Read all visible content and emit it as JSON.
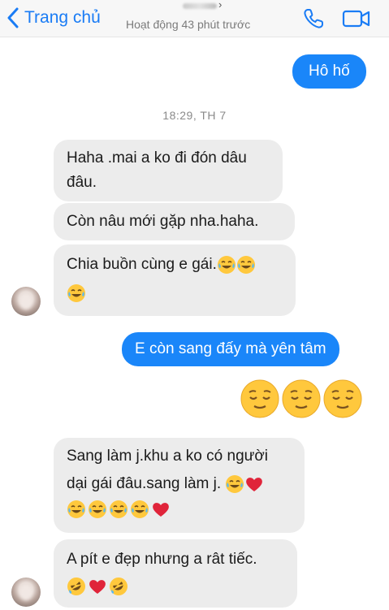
{
  "header": {
    "back_label": "Trang chủ",
    "status": "Hoạt động 43 phút trước",
    "icons": [
      "back-chevron-icon",
      "phone-icon",
      "video-camera-icon"
    ],
    "accent": "#1a7cf5"
  },
  "messages": {
    "out1": "Hô hố",
    "timestamp": "18:29, TH 7",
    "in1": "Haha .mai a ko đi đón dâu đâu.",
    "in2": "Còn nâu mới gặp nha.haha.",
    "in3": "Chia buồn cùng e gái.",
    "out2": "E còn sang đấy mà yên tâm",
    "in4": "Sang làm j.khu a ko có người dại gái đâu.sang làm j.",
    "in5": "A pít e đẹp nhưng a rât tiếc."
  },
  "colors": {
    "outgoing_bubble": "#1a86f9",
    "incoming_bubble": "#ececec",
    "heart": "#e0243a",
    "emoji_face": "#ffc83d"
  }
}
